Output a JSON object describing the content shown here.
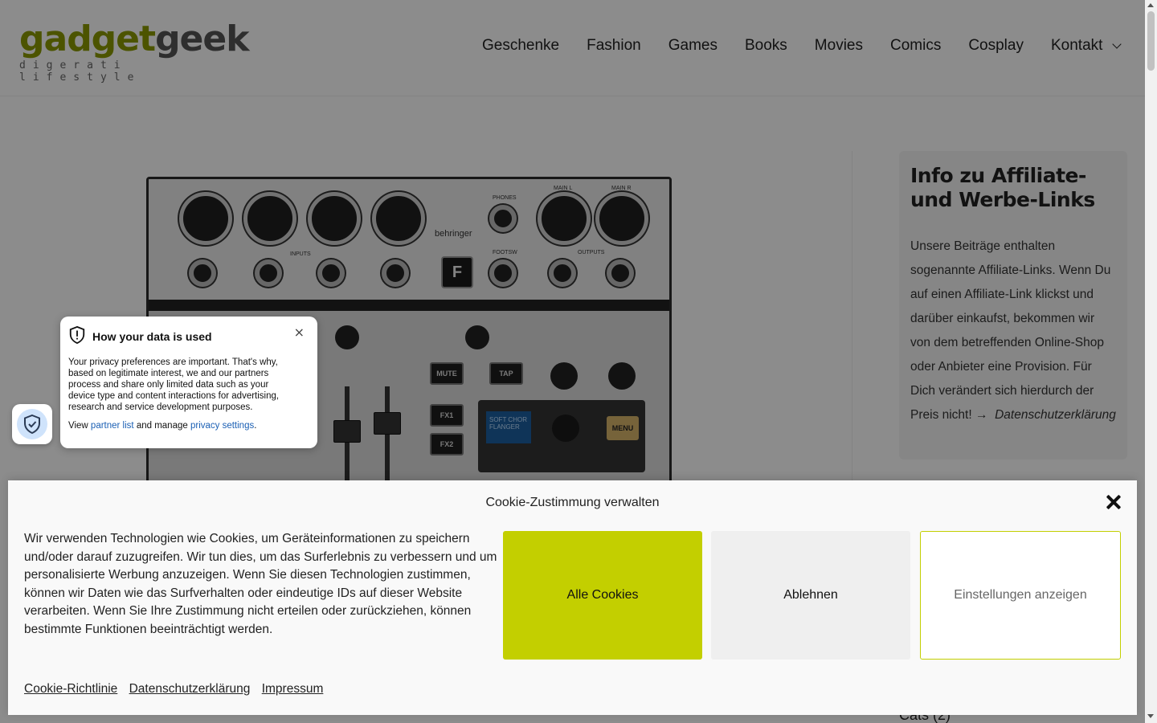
{
  "logo": {
    "part1": "gadget",
    "part2": "geek",
    "tagline": "digerati lifestyle"
  },
  "nav": {
    "items": [
      {
        "label": "Geschenke"
      },
      {
        "label": "Fashion"
      },
      {
        "label": "Games"
      },
      {
        "label": "Books"
      },
      {
        "label": "Movies"
      },
      {
        "label": "Comics"
      },
      {
        "label": "Cosplay"
      },
      {
        "label": "Kontakt"
      }
    ],
    "kontakt_icon": "chevron-down-icon"
  },
  "product_image": {
    "brand": "behringer",
    "fx_button": "F",
    "buttons": [
      "MUTE",
      "TAP",
      "FX1",
      "FX2"
    ],
    "screen_text": "SOFT CHOR FLANGER",
    "menu": "MENU",
    "labels": [
      "PHONES",
      "MAIN L",
      "MAIN R",
      "FOOTSW",
      "OUTPUTS",
      "INPUTS"
    ]
  },
  "sidebar": {
    "title": "Info zu Affiliate- und Werbe-Links",
    "text": "Unsere Beiträge enthalten sogenannte Affiliate-Links. Wenn Du auf einen Affiliate-Link klickst und darüber einkaufst, bekommen wir von dem betreffenden Online-Shop oder Anbieter eine Provision. Für Dich verändert sich hierdurch der Preis nicht! →",
    "link": "Datenschutzerklärung",
    "cats_label": "Cats (2)"
  },
  "privacy_popup": {
    "title": "How your data is used",
    "body": "Your privacy preferences are important. That's why, based on legitimate interest, we and our partners process and share only limited data such as your device type and content interactions for advertising, research and service development purposes.",
    "links_prefix": "View",
    "partner_link": "partner list",
    "links_middle": "and manage",
    "settings_link": "privacy settings",
    "links_suffix": ".",
    "close": "×",
    "icon": "shield-icon"
  },
  "cookie_banner": {
    "title": "Cookie-Zustimmung verwalten",
    "text": "Wir verwenden Technologien wie Cookies, um Geräteinformationen zu speichern und/oder darauf zuzugreifen. Wir tun dies, um das Surferlebnis zu verbessern und um personalisierte Werbung anzuzeigen. Wenn Sie diesen Technologien zustimmen, können wir Daten wie das Surfverhalten oder eindeutige IDs auf dieser Website verarbeiten. Wenn Sie Ihre Zustimmung nicht erteilen oder zurückziehen, können bestimmte Funktionen beeinträchtigt werden.",
    "accept_label": "Alle Cookies",
    "deny_label": "Ablehnen",
    "settings_label": "Einstellungen anzeigen",
    "links": [
      "Cookie-Richtlinie",
      "Datenschutzerklärung",
      "Impressum"
    ],
    "accent_color": "#c3cf00"
  }
}
